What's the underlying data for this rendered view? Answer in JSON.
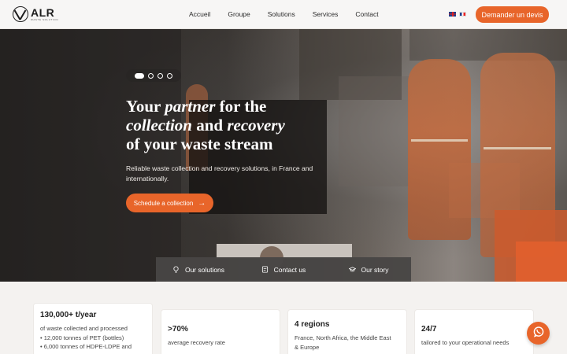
{
  "header": {
    "logo": {
      "name": "ALR",
      "tagline": "WASTE SOLUTION"
    },
    "menu": [
      "Accueil",
      "Groupe",
      "Solutions",
      "Services",
      "Contact"
    ],
    "languages": [
      "en-flag-icon",
      "fr-flag-icon"
    ],
    "quote_button": "Demander un devis"
  },
  "hero": {
    "carousel": {
      "count": 4,
      "active_index": 0
    },
    "title": {
      "line1_start": "Your ",
      "line1_italic": "partner",
      "line1_end": " for the",
      "line2_italic_a": "collection",
      "line2_mid": " and ",
      "line2_italic_b": "recovery",
      "line3": "of your waste stream"
    },
    "description": "Reliable waste collection and recovery solutions, in France and internationally.",
    "cta_label": "Schedule a collection",
    "quick_links": [
      {
        "label": "Our solutions",
        "icon": "lightbulb-icon"
      },
      {
        "label": "Contact us",
        "icon": "contact-icon"
      },
      {
        "label": "Our story",
        "icon": "graduation-cap-icon"
      }
    ]
  },
  "stats": [
    {
      "value": "130,000+ t/year",
      "lines": [
        "of waste collected and processed",
        "• 12,000 tonnes of PET (bottles)",
        "• 6,000 tonnes of HDPE-LDPE and"
      ]
    },
    {
      "value": ">70%",
      "lines": [
        "average recovery rate"
      ]
    },
    {
      "value": "4 regions",
      "lines": [
        "France, North Africa, the Middle East",
        "& Europe"
      ]
    },
    {
      "value": "24/7",
      "lines": [
        "tailored to your operational needs"
      ]
    }
  ],
  "chat_button_icon": "whatsapp-icon",
  "colors": {
    "accent": "#e8652a",
    "nav_bg": "#f7f6f5",
    "page_bg": "#f4f2f0"
  }
}
